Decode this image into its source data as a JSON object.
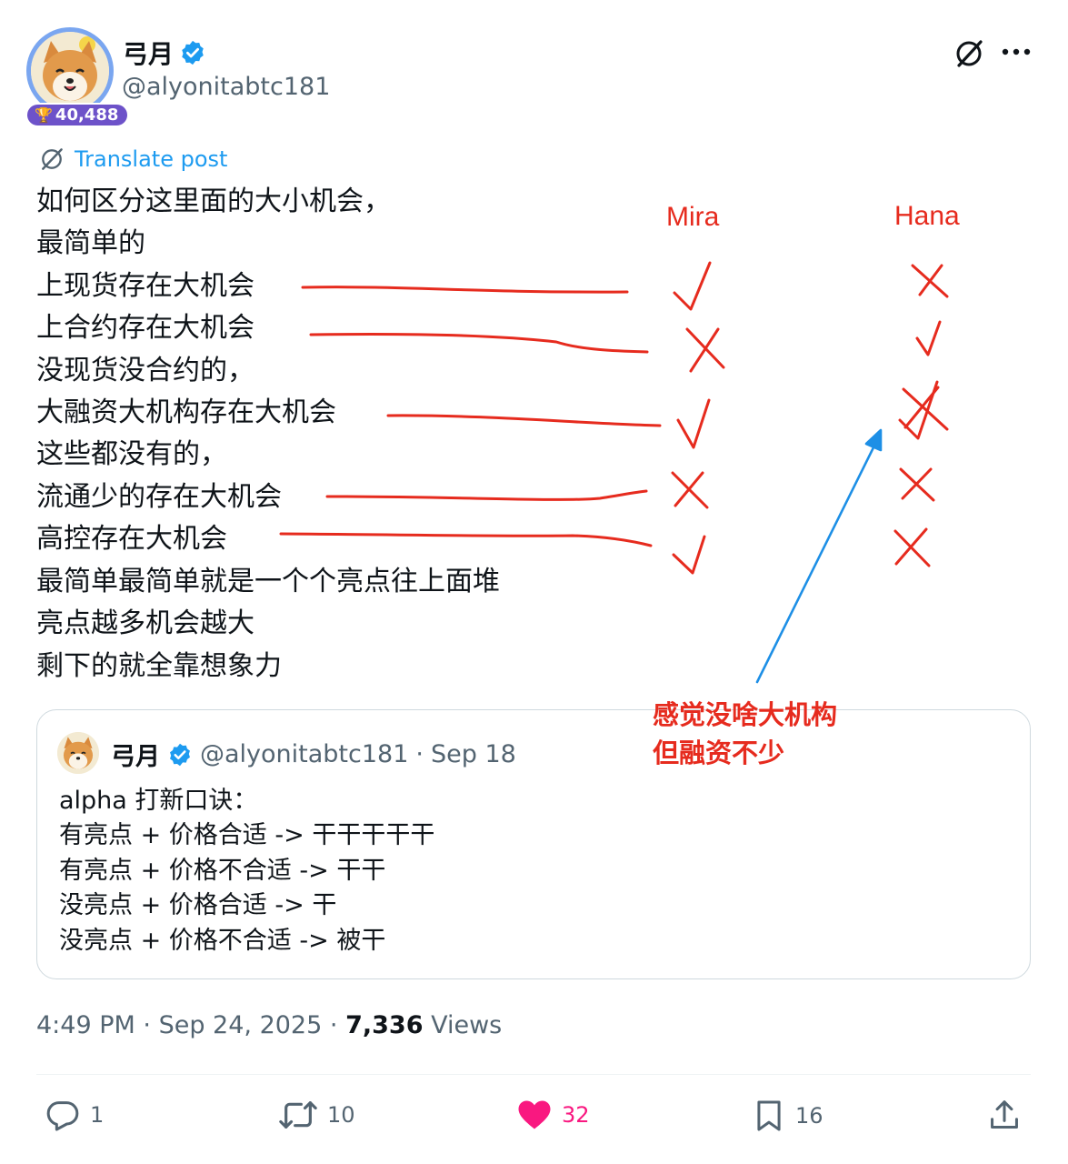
{
  "author": {
    "name": "弓月",
    "handle": "@alyonitabtc181",
    "score_badge": "40,488",
    "verified": true
  },
  "header_icons": [
    "grok-icon",
    "more-icon"
  ],
  "translate_label": "Translate post",
  "post_lines": [
    "如何区分这里面的大小机会，",
    "最简单的",
    "上现货存在大机会",
    "上合约存在大机会",
    "没现货没合约的，",
    "大融资大机构存在大机会",
    "这些都没有的，",
    "流通少的存在大机会",
    "高控存在大机会",
    "最简单最简单就是一个个亮点往上面堆",
    "亮点越多机会越大",
    "剩下的就全靠想象力"
  ],
  "annotation": {
    "columns": [
      "Mira",
      "Hana"
    ],
    "mira_marks": [
      "check",
      "cross",
      "check",
      "cross",
      "check"
    ],
    "hana_marks": [
      "cross",
      "check",
      "cross-over-check",
      "cross",
      "cross"
    ],
    "note_lines": [
      "感觉没啥大机构",
      "但融资不少"
    ],
    "color": "#e62b1e",
    "arrow_color": "#1d8fe6"
  },
  "quote": {
    "name": "弓月",
    "handle": "@alyonitabtc181",
    "separator": "·",
    "date": "Sep 18",
    "lines": [
      "alpha 打新口诀：",
      "有亮点 + 价格合适 -> 干干干干干",
      "有亮点 + 价格不合适 -> 干干",
      "没亮点 + 价格合适 -> 干",
      "没亮点 + 价格不合适 -> 被干"
    ]
  },
  "meta": {
    "time": "4:49 PM",
    "sep1": "·",
    "date": "Sep 24, 2025",
    "sep2": "·",
    "views_count": "7,336",
    "views_label": "Views"
  },
  "actions": {
    "replies": "1",
    "reposts": "10",
    "likes": "32",
    "bookmarks": "16"
  },
  "colors": {
    "accent": "#1d9bf0",
    "like": "#f91880",
    "text": "#0f1419",
    "secondary": "#536471",
    "badge": "#6d52c9"
  }
}
